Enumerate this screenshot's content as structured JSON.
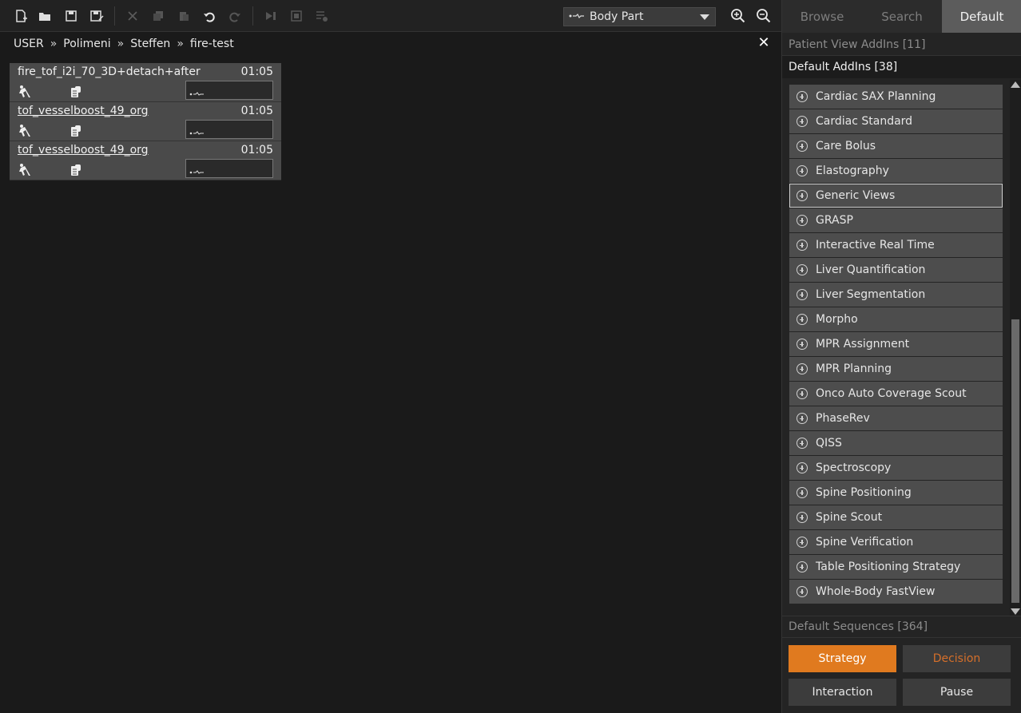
{
  "toolbar": {
    "icons": [
      "new-file-icon",
      "open-folder-icon",
      "save-icon",
      "save-as-icon",
      "delete-icon",
      "copy-icon",
      "paste-icon",
      "undo-icon",
      "redo-icon",
      "skip-icon",
      "fit-icon",
      "list-settings-icon"
    ],
    "body_part": "Body Part",
    "zoom_in": "zoom-in-icon",
    "zoom_out": "zoom-out-icon"
  },
  "breadcrumb": [
    "USER",
    "Polimeni",
    "Steffen",
    "fire-test"
  ],
  "breadcrumb_sep": "»",
  "close": "✕",
  "protocols": [
    {
      "name": "fire_tof_i2i_70_3D+detach+after",
      "time": "01:05",
      "underlined": false
    },
    {
      "name": "tof_vesselboost_49_org",
      "time": "01:05",
      "underlined": true
    },
    {
      "name": "tof_vesselboost_49_org",
      "time": "01:05",
      "underlined": true
    }
  ],
  "right_panel": {
    "tabs": [
      {
        "label": "Browse",
        "active": false
      },
      {
        "label": "Search",
        "active": false
      },
      {
        "label": "Default",
        "active": true
      }
    ],
    "patient_view_addins": "Patient View AddIns [11]",
    "default_addins": "Default AddIns [38]",
    "addins": [
      "Cardiac SAX Planning",
      "Cardiac Standard",
      "Care Bolus",
      "Elastography",
      "Generic Views",
      "GRASP",
      "Interactive Real Time",
      "Liver Quantification",
      "Liver Segmentation",
      "Morpho",
      "MPR Assignment",
      "MPR Planning",
      "Onco Auto Coverage Scout",
      "PhaseRev",
      "QISS",
      "Spectroscopy",
      "Spine Positioning",
      "Spine Scout",
      "Spine Verification",
      "Table Positioning Strategy",
      "Whole-Body FastView"
    ],
    "selected_addin": "Generic Views",
    "default_sequences": "Default Sequences [364]",
    "buttons": {
      "strategy": "Strategy",
      "decision": "Decision",
      "interaction": "Interaction",
      "pause": "Pause"
    }
  },
  "colors": {
    "accent": "#e07a1f",
    "warning_text": "#d56f2a"
  }
}
